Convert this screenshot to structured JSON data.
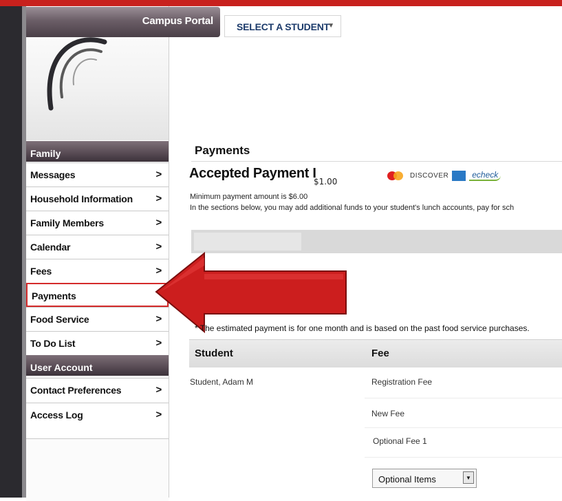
{
  "header": {
    "portal_title": "Campus Portal",
    "student_select_label": "SELECT A STUDENT"
  },
  "sidebar": {
    "family_header": "Family",
    "user_account_header": "User Account",
    "items": [
      {
        "label": "Messages"
      },
      {
        "label": "Household Information"
      },
      {
        "label": "Family Members"
      },
      {
        "label": "Calendar"
      },
      {
        "label": "Fees"
      },
      {
        "label": "Payments",
        "active": true
      },
      {
        "label": "Food Service"
      },
      {
        "label": "To Do List"
      }
    ],
    "account_items": [
      {
        "label": "Contact Preferences"
      },
      {
        "label": "Access Log"
      }
    ],
    "chevron": ">"
  },
  "main": {
    "title": "Payments",
    "accepted_heading": "Accepted Payment I",
    "amount_overlay": "$1.00",
    "cards": {
      "discover": "DISCOVER",
      "echeck": "echeck"
    },
    "minimum_text": "Minimum payment amount is $6.00",
    "intro_text": "In the sections below, you may add additional funds to your student's lunch accounts, pay for sch",
    "footnote": "* The estimated payment is for one month and is based on the past food service purchases.",
    "table": {
      "col_student": "Student",
      "col_fee": "Fee",
      "student_name": "Student, Adam M",
      "fees": [
        "Registration Fee",
        "New Fee",
        "Optional Fee 1"
      ]
    },
    "optional_select": "Optional Items"
  },
  "colors": {
    "accent_red": "#c8211d",
    "nav_header": "#5a4d56",
    "link_blue": "#1c3b6b"
  }
}
